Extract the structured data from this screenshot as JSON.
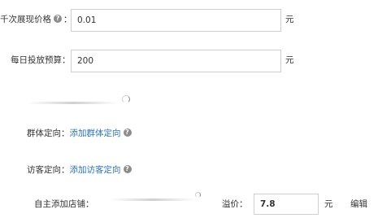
{
  "form": {
    "cpm_price": {
      "label": "千次展现价格",
      "value": "0.01",
      "unit": "元",
      "help_icon": "question-circle-icon"
    },
    "daily_budget": {
      "label": "每日投放预算：",
      "value": "200",
      "unit": "元"
    },
    "group_targeting": {
      "label": "群体定向：",
      "link": "添加群体定向",
      "help_icon": "question-circle-icon"
    },
    "visitor_targeting": {
      "label": "访客定向：",
      "link": "添加访客定向",
      "help_icon": "question-circle-icon"
    },
    "custom_shop": {
      "label": "自主添加店铺：",
      "premium_label": "溢价：",
      "premium_value": "7.8",
      "unit": "元",
      "edit_label": "编辑"
    }
  },
  "colors": {
    "link": "#2a73c8",
    "border": "#cfcfcf",
    "text": "#333333"
  }
}
